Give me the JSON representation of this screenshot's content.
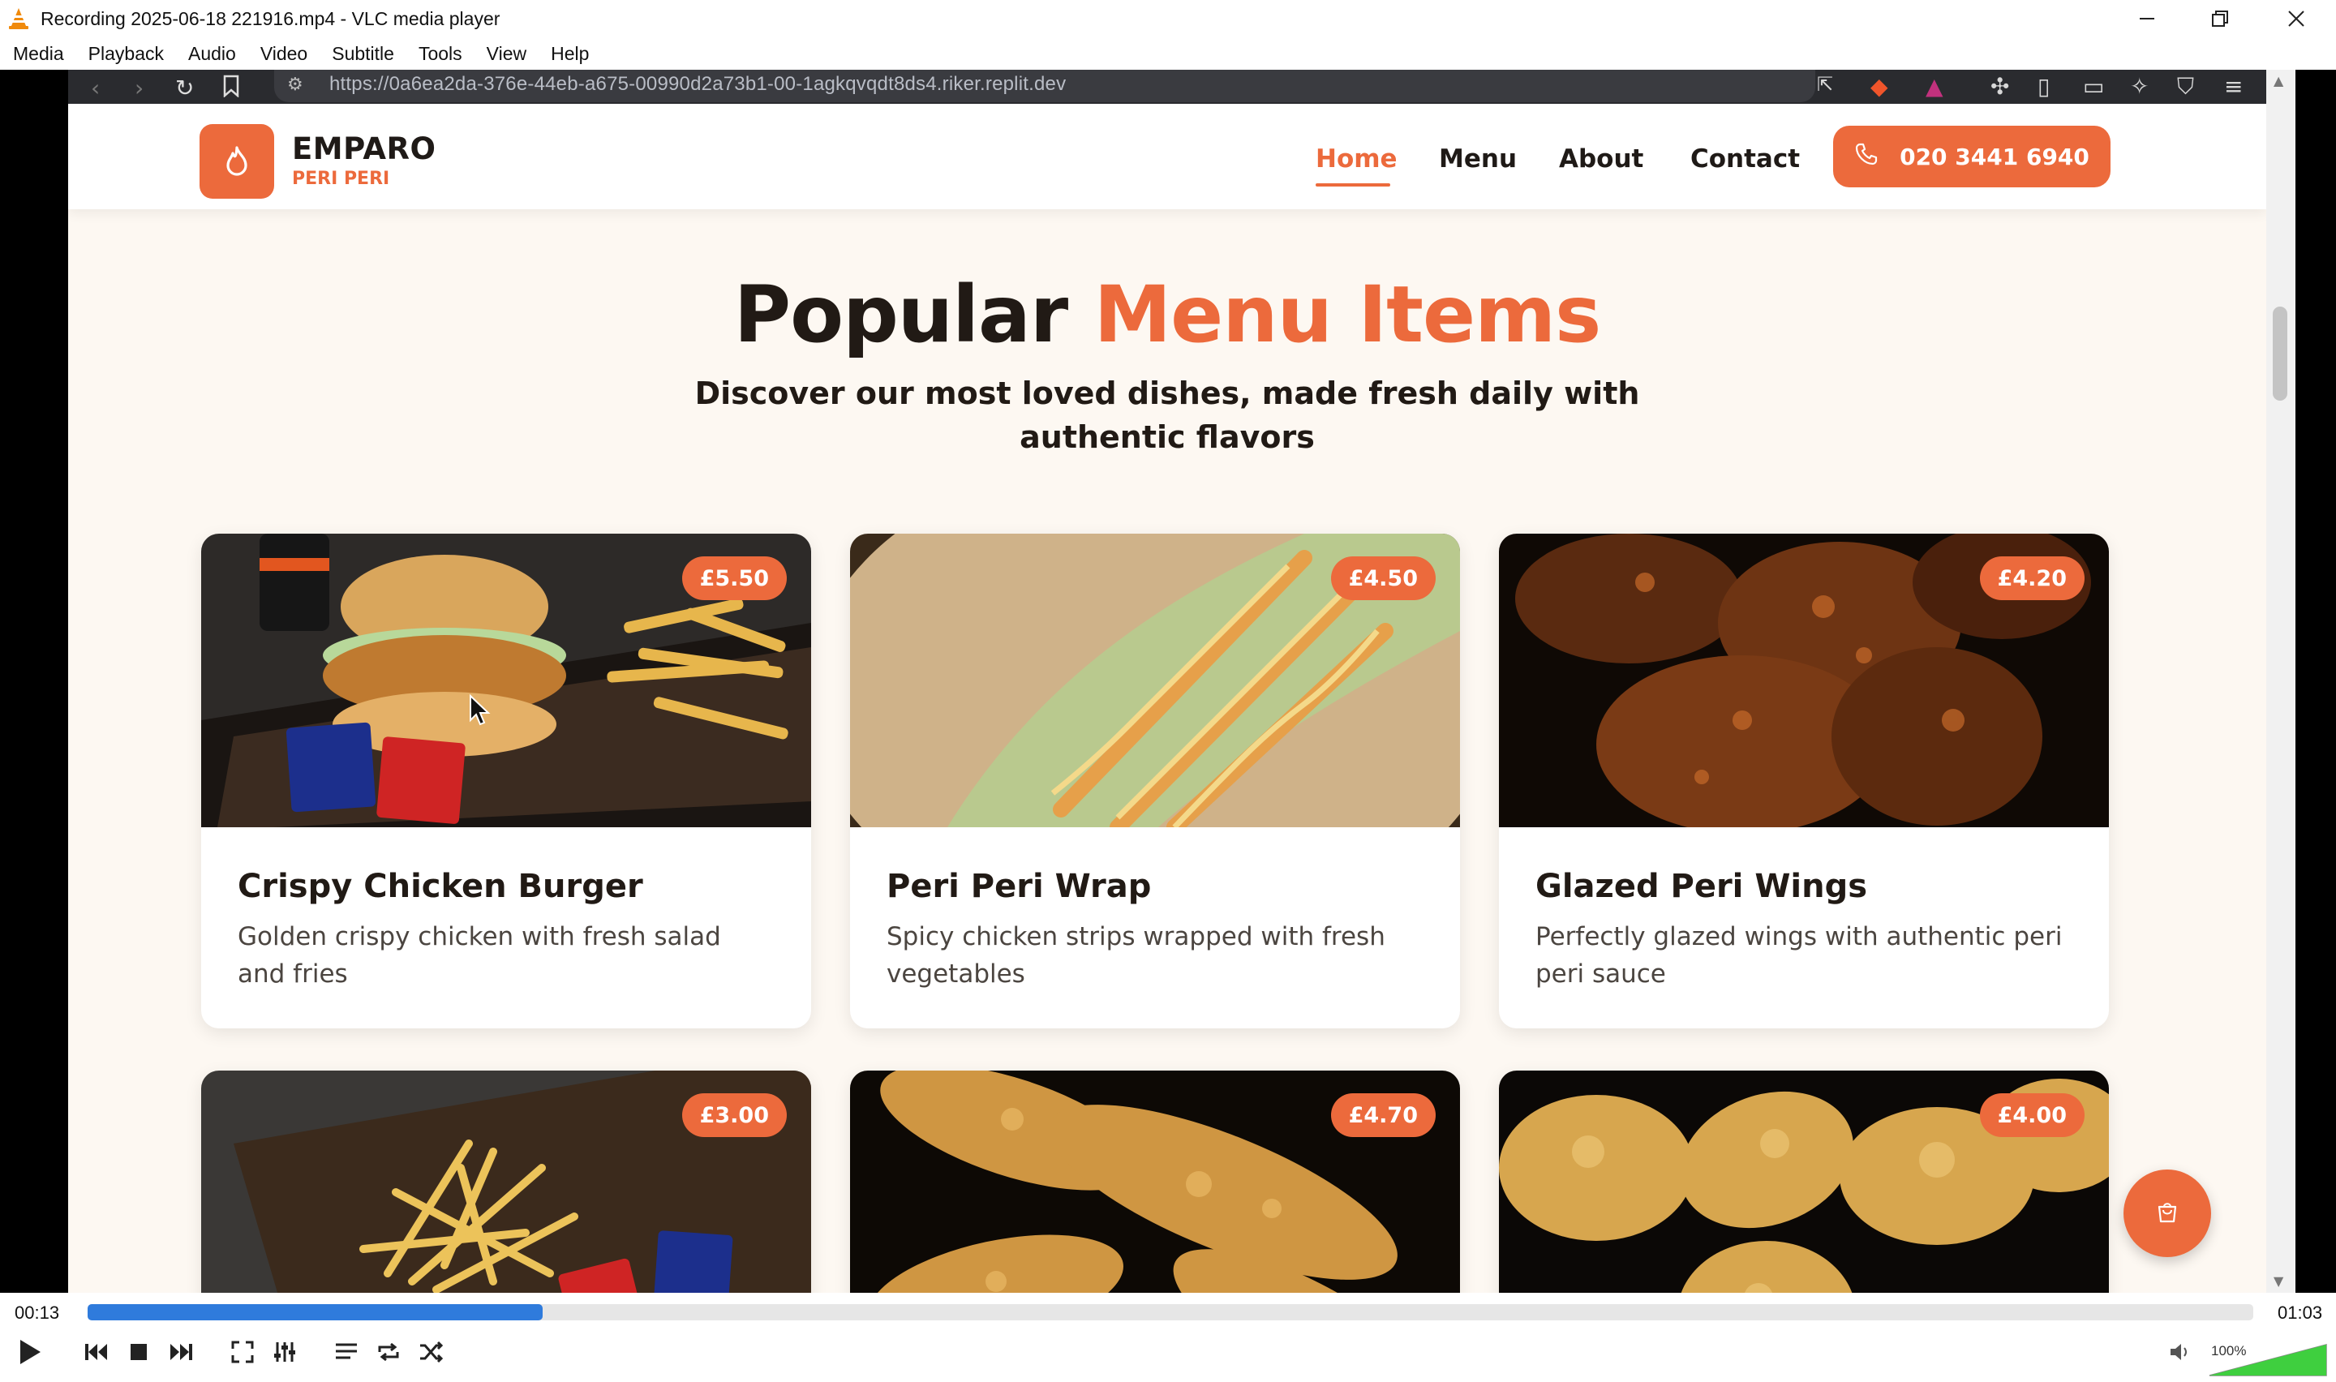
{
  "window": {
    "title": "Recording 2025-06-18 221916.mp4 - VLC media player",
    "menu": [
      "Media",
      "Playback",
      "Audio",
      "Video",
      "Subtitle",
      "Tools",
      "View",
      "Help"
    ],
    "controls": [
      "minimize-icon",
      "restore-icon",
      "close-icon"
    ]
  },
  "browser": {
    "url": "https://0a6ea2da-376e-44eb-a675-00990d2a73b1-00-1agkqvqdt8ds4.riker.replit.dev"
  },
  "site": {
    "logo_name": "EMPARO",
    "logo_sub": "PERI PERI",
    "nav": [
      "Home",
      "Menu",
      "About",
      "Contact"
    ],
    "active_nav": "Home",
    "phone": "020 3441 6940",
    "accent_color": "#ec6a3c",
    "heading_plain": "Popular",
    "heading_accent": "Menu Items",
    "subheading": "Discover our most loved dishes, made fresh daily with authentic flavors",
    "items": [
      {
        "name": "Crispy Chicken Burger",
        "price": "£5.50",
        "desc": "Golden crispy chicken with fresh salad and fries"
      },
      {
        "name": "Peri Peri Wrap",
        "price": "£4.50",
        "desc": "Spicy chicken strips wrapped with fresh vegetables"
      },
      {
        "name": "Glazed Peri Wings",
        "price": "£4.20",
        "desc": "Perfectly glazed wings with authentic peri peri sauce"
      },
      {
        "name": "",
        "price": "£3.00",
        "desc": ""
      },
      {
        "name": "",
        "price": "£4.70",
        "desc": ""
      },
      {
        "name": "",
        "price": "£4.00",
        "desc": ""
      }
    ]
  },
  "player": {
    "elapsed": "00:13",
    "total": "01:03",
    "progress_fraction": 0.21,
    "volume": "100%",
    "volume_fraction": 1.0,
    "progress_color": "#2f7bdc"
  }
}
